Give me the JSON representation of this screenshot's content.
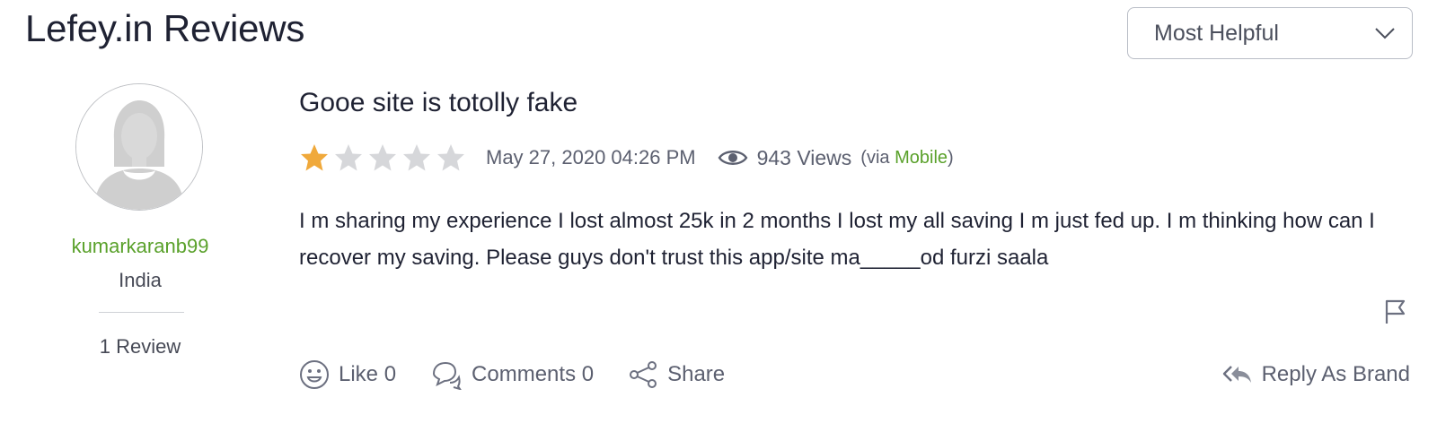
{
  "page": {
    "title": "Lefey.in Reviews"
  },
  "sort": {
    "selected": "Most Helpful",
    "icon": "chevron-down-icon"
  },
  "reviewer": {
    "username": "kumarkaranb99",
    "country": "India",
    "review_count": "1 Review",
    "avatar_icon": "default-avatar-icon",
    "username_color": "#5aa12b"
  },
  "review": {
    "title": "Gooe site is totolly fake",
    "rating": 1,
    "rating_max": 5,
    "star_color_filled": "#f0a93b",
    "star_color_empty": "#d6d7da",
    "date": "May 27, 2020 04:26 PM",
    "views": "943 Views",
    "via_prefix": "(via ",
    "via_source": "Mobile",
    "via_suffix": ")",
    "body": "I m sharing my experience I lost almost 25k in 2 months I lost my all saving I m just fed up. I m thinking how can I recover my saving. Please guys don't trust this app/site ma_____od furzi saala"
  },
  "actions": {
    "like_label": "Like 0",
    "comments_label": "Comments 0",
    "share_label": "Share",
    "reply_label": "Reply As Brand",
    "flag_icon": "flag-icon"
  }
}
